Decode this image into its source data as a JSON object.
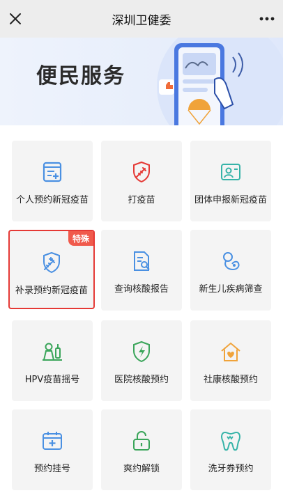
{
  "header": {
    "title": "深圳卫健委",
    "close_icon": "close-icon",
    "more_icon": "more-icon"
  },
  "banner": {
    "heading": "便民服务"
  },
  "colors": {
    "blue": "#4a90e2",
    "red": "#e53935",
    "green": "#3aa55a",
    "orange": "#f0a33a",
    "teal": "#36b3a8"
  },
  "services": [
    {
      "label": "个人预约新冠疫苗",
      "icon": "vaccine-form-icon"
    },
    {
      "label": "打疫苗",
      "icon": "syringe-shield-icon"
    },
    {
      "label": "团体申报新冠疫苗",
      "icon": "group-card-icon"
    },
    {
      "label": "补录预约新冠疫苗",
      "icon": "shield-syringe-icon",
      "badge": "特殊"
    },
    {
      "label": "查询核酸报告",
      "icon": "report-search-icon"
    },
    {
      "label": "新生儿疾病筛查",
      "icon": "baby-icon"
    },
    {
      "label": "HPV疫苗摇号",
      "icon": "female-vaccine-icon"
    },
    {
      "label": "医院核酸预约",
      "icon": "shield-bolt-icon"
    },
    {
      "label": "社康核酸预约",
      "icon": "house-heart-icon"
    },
    {
      "label": "预约挂号",
      "icon": "calendar-plus-icon"
    },
    {
      "label": "爽约解锁",
      "icon": "unlock-icon"
    },
    {
      "label": "洗牙券预约",
      "icon": "tooth-icon"
    }
  ]
}
